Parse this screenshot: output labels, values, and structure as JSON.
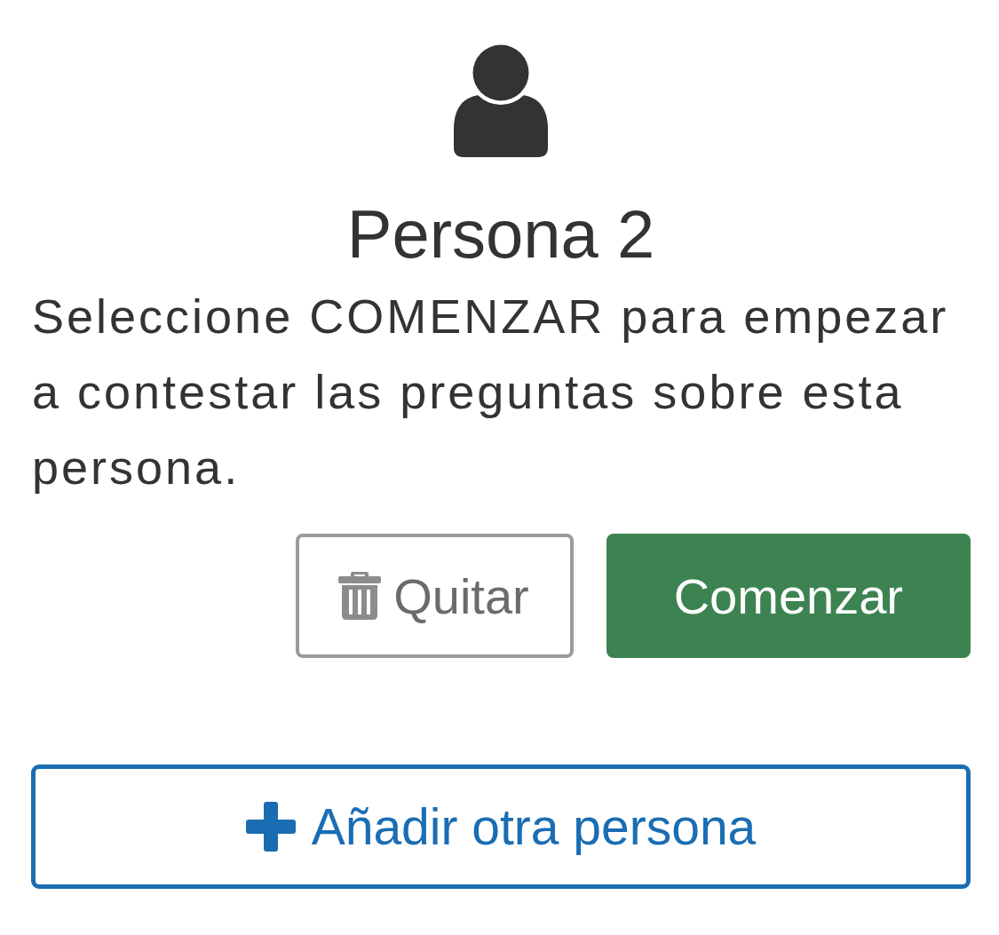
{
  "profile": {
    "title": "Persona 2",
    "instructions": "Seleccione COMENZAR para empezar a contestar las preguntas sobre esta persona."
  },
  "actions": [
    {
      "kind": "remove",
      "label": "Quitar"
    },
    {
      "kind": "start",
      "label": "Comenzar"
    }
  ],
  "add_button": {
    "label": "Añadir otra persona"
  }
}
